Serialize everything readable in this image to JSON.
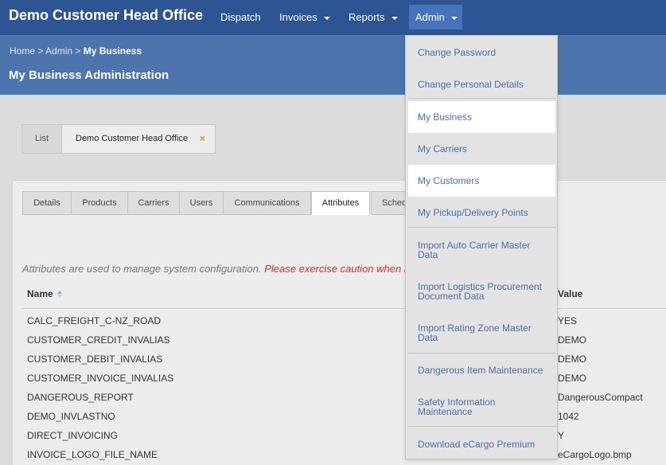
{
  "navbar": {
    "brand": "Demo Customer Head Office",
    "items": [
      {
        "label": "Dispatch",
        "has_caret": false
      },
      {
        "label": "Invoices",
        "has_caret": true
      },
      {
        "label": "Reports",
        "has_caret": true
      },
      {
        "label": "Admin",
        "has_caret": true,
        "active": true
      }
    ]
  },
  "breadcrumb": {
    "home": "Home",
    "sep1": ">",
    "admin": "Admin",
    "sep2": ">",
    "current": "My Business"
  },
  "page_title": "My Business Administration",
  "record_tabs": {
    "list": "List",
    "active": "Demo Customer Head Office",
    "close": "×"
  },
  "detail_tabs": [
    {
      "label": "Details"
    },
    {
      "label": "Products"
    },
    {
      "label": "Carriers"
    },
    {
      "label": "Users"
    },
    {
      "label": "Communications"
    },
    {
      "label": "Attributes",
      "active": true
    },
    {
      "label": "Sched"
    }
  ],
  "note": {
    "text": "Attributes are used to manage system configuration.",
    "warning": "Please exercise caution when m"
  },
  "table": {
    "columns": {
      "name": "Name",
      "value": "Value"
    },
    "rows": [
      {
        "name": "CALC_FREIGHT_C-NZ_ROAD",
        "value": "YES"
      },
      {
        "name": "CUSTOMER_CREDIT_INVALIAS",
        "value": "DEMO"
      },
      {
        "name": "CUSTOMER_DEBIT_INVALIAS",
        "value": "DEMO"
      },
      {
        "name": "CUSTOMER_INVOICE_INVALIAS",
        "value": "DEMO"
      },
      {
        "name": "DANGEROUS_REPORT",
        "value": "DangerousCompact"
      },
      {
        "name": "DEMO_INVLASTNO",
        "value": "1042"
      },
      {
        "name": "DIRECT_INVOICING",
        "value": "Y"
      },
      {
        "name": "INVOICE_LOGO_FILE_NAME",
        "value": "eCargoLogo.bmp"
      }
    ]
  },
  "admin_menu": {
    "items": [
      {
        "line1": "Change Password",
        "line2": ""
      },
      {
        "line1": "Change Personal Details",
        "line2": ""
      },
      {
        "line1": "My Business",
        "line2": "",
        "highlighted": true
      },
      {
        "line1": "My Carriers",
        "line2": ""
      },
      {
        "line1": "My Customers",
        "line2": "",
        "highlighted": true
      },
      {
        "line1": "My Pickup/Delivery Points",
        "line2": ""
      },
      {
        "line1": "Import Auto Carrier Master",
        "line2": "Data"
      },
      {
        "line1": "Import Logistics Procurement",
        "line2": "Document Data"
      },
      {
        "line1": "Import Rating Zone Master",
        "line2": "Data"
      },
      {
        "line1": "Dangerous Item Maintenance",
        "line2": ""
      },
      {
        "line1": "Safety Information",
        "line2": "Maintenance"
      },
      {
        "line1": "Download eCargo Premium",
        "line2": ""
      }
    ]
  },
  "colors": {
    "navbar": "#2d5593",
    "header": "#4d74ad",
    "active_nav": "#4673ba",
    "link": "#4a6fa8",
    "warning": "#d9302a",
    "close_icon": "#d39a2d"
  }
}
